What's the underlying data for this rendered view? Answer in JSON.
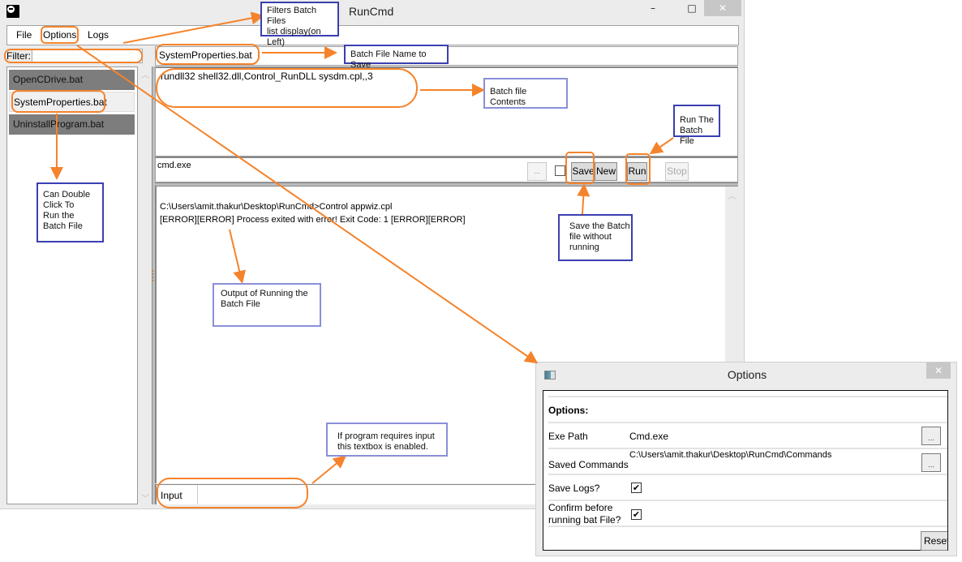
{
  "window": {
    "title": "RunCmd",
    "controls": {
      "minimize": "–",
      "maximize": "□",
      "close": "✕"
    }
  },
  "menu": {
    "items": [
      {
        "label": "File"
      },
      {
        "label": "Options"
      },
      {
        "label": "Logs"
      }
    ]
  },
  "filter": {
    "label": "Filter:",
    "value": ""
  },
  "file_list": {
    "items": [
      {
        "label": "OpenCDrive.bat",
        "state": "default"
      },
      {
        "label": "SystemProperties.bat",
        "state": "selected"
      },
      {
        "label": "UninstallProgram.bat",
        "state": "default"
      }
    ]
  },
  "editor": {
    "batch_name": "SystemProperties.bat",
    "contents": "rundll32 shell32.dll,Control_RunDLL sysdm.cpl,,3"
  },
  "toolbar": {
    "exe": "cmd.exe",
    "browse_label": "...",
    "checkbox_checked": false,
    "save_label": "Save",
    "new_label": "New",
    "run_label": "Run",
    "stop_label": "Stop"
  },
  "output": {
    "lines": [
      "C:\\Users\\amit.thakur\\Desktop\\RunCmd>Control appwiz.cpl",
      "[ERROR][ERROR] Process exited with error! Exit Code: 1 [ERROR][ERROR]"
    ]
  },
  "input": {
    "label": "Input",
    "value": ""
  },
  "options_dialog": {
    "title": "Options",
    "close": "✕",
    "heading": "Options:",
    "exe_path_label": "Exe Path",
    "exe_path_value": "Cmd.exe",
    "saved_commands_label": "Saved Commands",
    "saved_commands_value": "C:\\Users\\amit.thakur\\Desktop\\RunCmd\\Commands",
    "browse_label": "...",
    "save_logs_label": "Save Logs?",
    "save_logs_checked": true,
    "confirm_label_line1": "Confirm before",
    "confirm_label_line2": "running bat File?",
    "confirm_checked": true,
    "check_mark": "✔",
    "reset_label": "Reset"
  },
  "annotations": {
    "filter_note": [
      "Filters Batch Files",
      "list display(on Left)"
    ],
    "batch_name_note": "Batch File Name to Save",
    "contents_note": "Batch file Contents",
    "run_note": [
      "Run The",
      "Batch File"
    ],
    "double_click_note": [
      "Can Double",
      "Click To",
      "Run the",
      "Batch File"
    ],
    "save_note": [
      "Save the Batch",
      "file without",
      "running"
    ],
    "output_note": [
      "Output of Running the",
      "Batch File"
    ],
    "input_note": [
      "If program requires input",
      "this textbox is enabled."
    ]
  },
  "colors": {
    "annotation_orange": "#f5832b",
    "annotation_blue": "#3b3fb0",
    "list_item_dark": "#7d7d7d"
  }
}
